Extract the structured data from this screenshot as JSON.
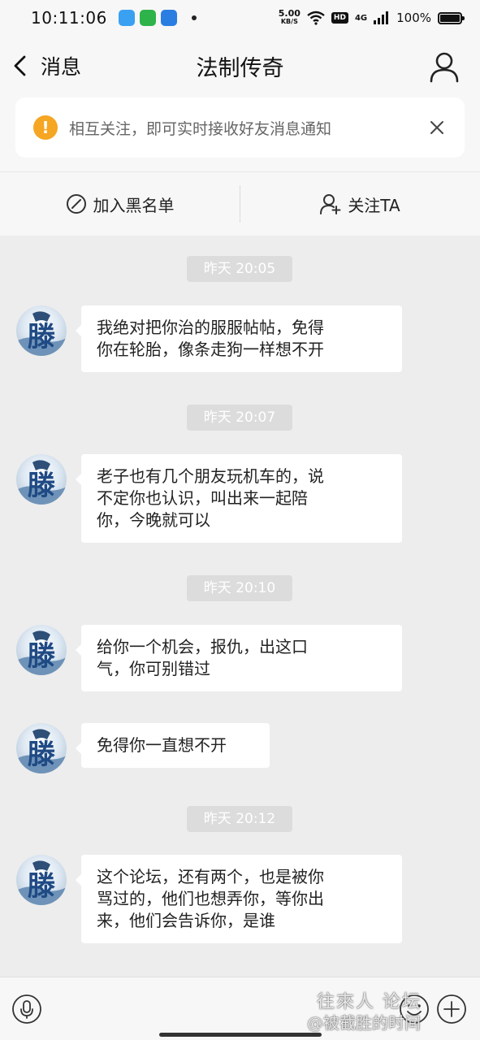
{
  "status_bar": {
    "time": "10:11:06",
    "net_speed": "5.00",
    "net_unit": "KB/S",
    "hd": "HD",
    "signal": "4G",
    "battery": "100%"
  },
  "header": {
    "back_label": "消息",
    "title": "法制传奇"
  },
  "notice": {
    "icon": "!",
    "text": "相互关注，即可实时接收好友消息通知"
  },
  "actions": {
    "block_label": "加入黑名单",
    "follow_label": "关注TA"
  },
  "messages": [
    {
      "timestamp": "昨天 20:05",
      "text_lines": [
        "我绝对把你治的服服帖帖，免得",
        "你在轮胎，像条走狗一样想不开"
      ]
    },
    {
      "timestamp": "昨天 20:07",
      "text_lines": [
        "老子也有几个朋友玩机车的，说",
        "不定你也认识，叫出来一起陪",
        "你，今晚就可以"
      ]
    },
    {
      "timestamp": "昨天 20:10",
      "text_lines": [
        "给你一个机会，报仇，出这口",
        "气，你可别错过"
      ]
    },
    {
      "timestamp": "",
      "text_lines": [
        "免得你一直想不开"
      ]
    },
    {
      "timestamp": "昨天 20:12",
      "text_lines": [
        "这个论坛，还有两个，也是被你",
        "骂过的，他们也想弄你，等你出",
        "来，他们会告诉你，是谁"
      ]
    }
  ],
  "avatar_glyph": "滕",
  "watermark": {
    "line1": "往來人 论坛",
    "line2": "@被截胜的时间"
  },
  "colors": {
    "background": "#ededed",
    "notice_icon": "#f5a623",
    "bubble": "#ffffff",
    "timestamp_pill": "#dcdcdc"
  }
}
